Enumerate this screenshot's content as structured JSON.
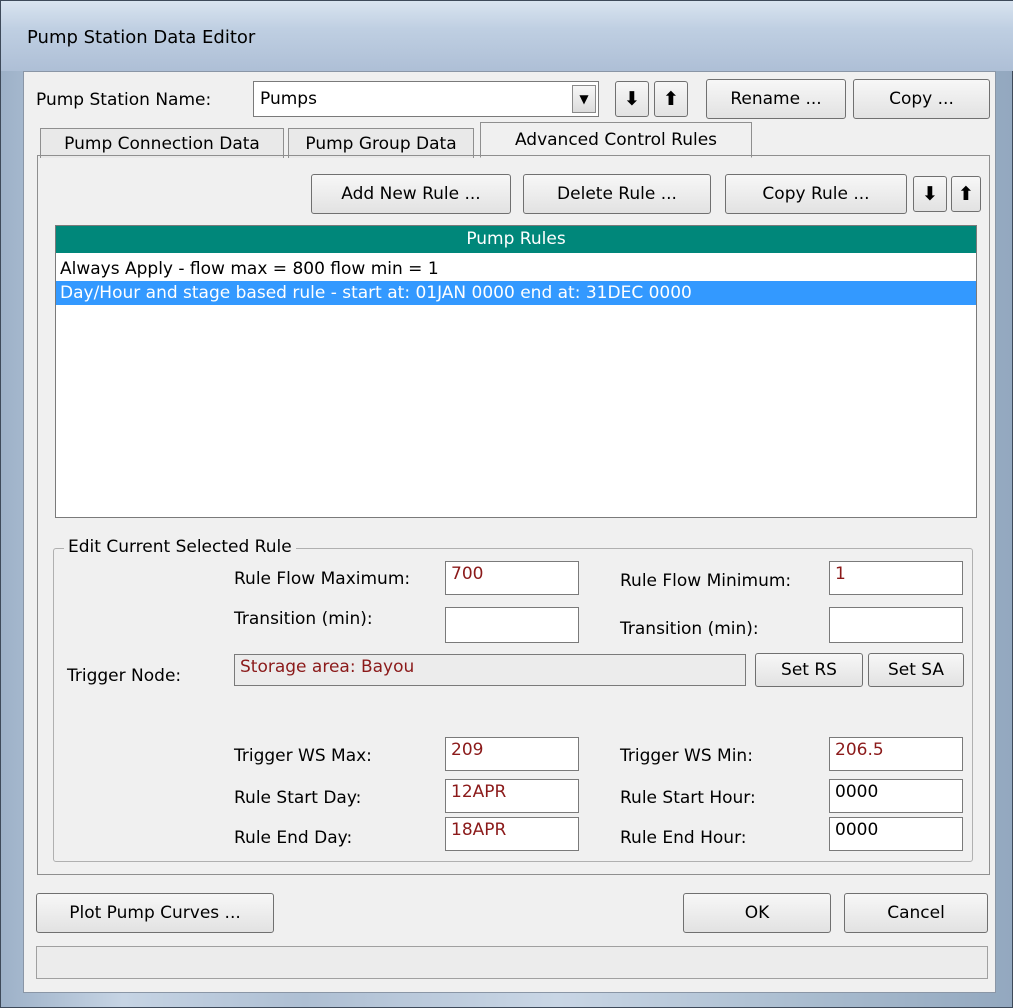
{
  "window": {
    "title": "Pump Station Data Editor"
  },
  "header": {
    "station_label": "Pump Station Name:",
    "station_value": "Pumps",
    "move_down": "⬇",
    "move_up": "⬆",
    "rename_label": "Rename ...",
    "copy_label": "Copy ..."
  },
  "tabs": [
    {
      "label": "Pump Connection Data"
    },
    {
      "label": "Pump Group Data"
    },
    {
      "label": "Advanced Control Rules"
    }
  ],
  "rules_toolbar": {
    "add_label": "Add New Rule ...",
    "delete_label": "Delete Rule ...",
    "copy_label": "Copy Rule ...",
    "move_down": "⬇",
    "move_up": "⬆"
  },
  "rules_list": {
    "header": "Pump Rules",
    "items": [
      {
        "text": "Always Apply - flow max = 800 flow min = 1",
        "selected": false
      },
      {
        "text": "Day/Hour and stage based rule - start at: 01JAN 0000 end at: 31DEC 0000",
        "selected": true
      }
    ]
  },
  "edit_rule": {
    "group_title": "Edit Current Selected Rule",
    "flow_max_label": "Rule Flow Maximum:",
    "flow_max_value": "700",
    "flow_min_label": "Rule Flow Minimum:",
    "flow_min_value": "1",
    "transition_label_left": "Transition (min):",
    "transition_value_left": "",
    "transition_label_right": "Transition (min):",
    "transition_value_right": "",
    "trigger_node_label": "Trigger Node:",
    "trigger_node_value": "Storage area: Bayou",
    "set_rs_label": "Set RS",
    "set_sa_label": "Set SA",
    "ws_max_label": "Trigger WS Max:",
    "ws_max_value": "209",
    "ws_min_label": "Trigger WS Min:",
    "ws_min_value": "206.5",
    "start_day_label": "Rule Start Day:",
    "start_day_value": "12APR",
    "start_hour_label": "Rule Start Hour:",
    "start_hour_value": "0000",
    "end_day_label": "Rule End Day:",
    "end_hour_label": "Rule End Hour:",
    "end_day_value": "18APR",
    "end_hour_value": "0000"
  },
  "footer": {
    "plot_label": "Plot Pump Curves ...",
    "ok_label": "OK",
    "cancel_label": "Cancel",
    "status_text": ""
  },
  "colors": {
    "list_header": "#00877a",
    "selection": "#3399ff",
    "field_text": "#8b1a1a"
  }
}
